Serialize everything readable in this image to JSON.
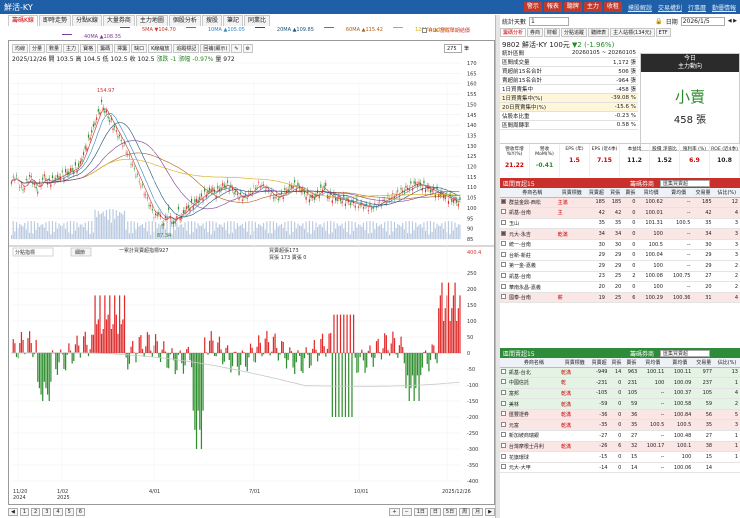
{
  "window": {
    "title": "鮮活-KY",
    "buttons": [
      "警示",
      "報表",
      "聽牌",
      "主力",
      "收租"
    ],
    "links": [
      "摸股解說",
      "交易權利",
      "行事曆",
      "勤優情報"
    ]
  },
  "tabs": [
    "籌碼K線",
    "即時走勢",
    "分點K線",
    "大量券商",
    "主力地圖",
    "個股分析",
    "搜股",
    "筆記",
    "同業比"
  ],
  "ma_legend_1": [
    {
      "label": "5MA ▼104.70",
      "color": "#c0392b"
    },
    {
      "label": "10MA ▲105.05",
      "color": "#2e86c1"
    },
    {
      "label": "20MA ▲109.85",
      "color": "#1a5276"
    },
    {
      "label": "60MA ▲115.42",
      "color": "#af601a"
    },
    {
      "label": "120MA ▲108.71",
      "color": "#d4ac0d"
    }
  ],
  "ma_legend_2": [
    {
      "label": "40MA ▲108.35",
      "color": "#7d3c98"
    }
  ],
  "ma_checkbox": "ROC當成年期結價",
  "chart_toolbar": [
    "均線",
    "分量",
    "數量",
    "主力",
    "寶格",
    "籌碼",
    "擇籌",
    "缺口",
    "K線縮放",
    "追蹤標記",
    "回補(顯示)"
  ],
  "zoom_value": "275",
  "zoom_unit": "筆",
  "price_info": {
    "text": "2025/12/26 開 103.5 高 104.5 低 102.5 收 102.5",
    "change": "漲跌 -1 漲幅 -0.97%",
    "vol": "量 972"
  },
  "high_label": "154.97",
  "low_label": "87.34",
  "price_axis": [
    "170",
    "165",
    "160",
    "155",
    "150",
    "145",
    "140",
    "135",
    "130",
    "125",
    "120",
    "115",
    "110",
    "105",
    "100",
    "95",
    "90",
    "85"
  ],
  "top_right_val": "400.4",
  "sub_legend": "一累計買賣超指標927",
  "sub_legend2": "買賣超張173",
  "sub_legend3": "買張 173 賣張 0",
  "sub_select": "分點指標",
  "sub_btn": "細節",
  "sub_axis": [
    "250",
    "200",
    "150",
    "100",
    "50",
    "0",
    "-50",
    "-100",
    "-150",
    "-200",
    "-250",
    "-300",
    "-350",
    "-400"
  ],
  "date_axis": [
    {
      "label": "11/20",
      "year": "2024"
    },
    {
      "label": "1/02",
      "year": "2025"
    },
    {
      "label": "4/01",
      "year": ""
    },
    {
      "label": "7/01",
      "year": ""
    },
    {
      "label": "10/01",
      "year": ""
    },
    {
      "label": "2025/12/26",
      "year": ""
    }
  ],
  "bottom_pages": [
    "1",
    "2",
    "3",
    "4",
    "5",
    "6"
  ],
  "bottom_zoom": [
    "1日",
    "日",
    "5日",
    "周",
    "月"
  ],
  "right": {
    "days_label": "統計天數",
    "days_value": "1",
    "date_label": "日期",
    "date_value": "2026/1/5",
    "tabs": [
      "籌碼分析",
      "券商",
      "財報",
      "分點追蹤",
      "聽牌表",
      "主人站標(134元)",
      "ETF"
    ],
    "stock": "9802 鮮活-KY",
    "price": "100元",
    "change": "▼2 (-1.96%)",
    "stats": [
      {
        "label": "統計區間",
        "value": "20260105 ~ 20260105",
        "span": true
      },
      {
        "label": "區間成交量",
        "value": "1,172 張"
      },
      {
        "label": "買超前15名合計",
        "value": "506 張"
      },
      {
        "label": "賣超前15名合計",
        "value": "-964 張"
      },
      {
        "label": "1日買賣集中",
        "value": "-458 張"
      },
      {
        "label": "1日買賣集中(%)",
        "value": "-39.08 %",
        "hl": true
      },
      {
        "label": "20日買賣集中(%)",
        "value": "-15.6 %",
        "hl": true
      },
      {
        "label": "佔股本比重",
        "value": "-0.23 %"
      },
      {
        "label": "區間周轉率",
        "value": "0.58 %"
      }
    ],
    "today": {
      "h1": "今日",
      "h2": "主力動向",
      "big": "小賣",
      "num": "458 張"
    },
    "fund": [
      {
        "label": "營收年增 YoY(%)",
        "value": "21.22",
        "color": "#c00"
      },
      {
        "label": "營收 MoM(%)",
        "value": "-0.41",
        "color": "#2a8a2a"
      },
      {
        "label": "EPS (年)",
        "value": "1.5",
        "color": "#c00"
      },
      {
        "label": "EPS (近4季)",
        "value": "7.15",
        "color": "#c00"
      },
      {
        "label": "本益比",
        "value": "11.2",
        "color": "#222"
      },
      {
        "label": "股價 淨值比",
        "value": "1.52",
        "color": "#222"
      },
      {
        "label": "殖利率 (%)",
        "value": "6.9",
        "color": "#c00"
      },
      {
        "label": "ROE (近4季)",
        "value": "10.8",
        "color": "#222"
      }
    ],
    "buy_header": "區間買超15",
    "buy_sel_label": "籌碼券商",
    "buy_sel": "匯集買賣超",
    "columns": [
      "券商名稱",
      "買賣標籤",
      "買賣超",
      "買張",
      "賣張",
      "買均價",
      "賣均價",
      "交易量",
      "佔比(%)"
    ],
    "buy_rows": [
      {
        "ck": true,
        "name": "群益金鼎-西松",
        "tag": "主滿",
        "net": "185",
        "buy": "185",
        "sell": "0",
        "bavg": "100.62",
        "savg": "--",
        "vol": "185",
        "pct": "12",
        "c": "pink"
      },
      {
        "ck": false,
        "name": "凱基-台南",
        "tag": "主",
        "net": "42",
        "buy": "42",
        "sell": "0",
        "bavg": "100.01",
        "savg": "--",
        "vol": "42",
        "pct": "4",
        "c": "pink"
      },
      {
        "ck": false,
        "name": "玉山",
        "tag": "",
        "net": "35",
        "buy": "35",
        "sell": "0",
        "bavg": "101.31",
        "savg": "100.5",
        "vol": "35",
        "pct": "3",
        "c": ""
      },
      {
        "ck": true,
        "name": "元大-永吉",
        "tag": "乾滿",
        "net": "34",
        "buy": "34",
        "sell": "0",
        "bavg": "100",
        "savg": "--",
        "vol": "34",
        "pct": "3",
        "c": "pink"
      },
      {
        "ck": false,
        "name": "統一-台南",
        "tag": "",
        "net": "30",
        "buy": "30",
        "sell": "0",
        "bavg": "100.5",
        "savg": "--",
        "vol": "30",
        "pct": "3",
        "c": ""
      },
      {
        "ck": false,
        "name": "台新-新莊",
        "tag": "",
        "net": "29",
        "buy": "29",
        "sell": "0",
        "bavg": "100.04",
        "savg": "--",
        "vol": "29",
        "pct": "3",
        "c": ""
      },
      {
        "ck": false,
        "name": "第一金-嘉義",
        "tag": "",
        "net": "29",
        "buy": "29",
        "sell": "0",
        "bavg": "100",
        "savg": "--",
        "vol": "29",
        "pct": "2",
        "c": ""
      },
      {
        "ck": false,
        "name": "凱基-台南",
        "tag": "",
        "net": "23",
        "buy": "25",
        "sell": "2",
        "bavg": "100.08",
        "savg": "100.75",
        "vol": "27",
        "pct": "2",
        "c": ""
      },
      {
        "ck": false,
        "name": "華南永昌-嘉義",
        "tag": "",
        "net": "20",
        "buy": "20",
        "sell": "0",
        "bavg": "100",
        "savg": "--",
        "vol": "20",
        "pct": "2",
        "c": ""
      },
      {
        "ck": false,
        "name": "國泰-台南",
        "tag": "薪",
        "net": "19",
        "buy": "25",
        "sell": "6",
        "bavg": "100.29",
        "savg": "100.36",
        "vol": "31",
        "pct": "4",
        "c": "pink"
      }
    ],
    "sell_header": "區間賣超15",
    "sell_sel_label": "籌碼券商",
    "sell_sel": "匯集買賣超",
    "sell_rows": [
      {
        "ck": false,
        "name": "凱基-台北",
        "tag": "乾滿",
        "net": "-949",
        "buy": "14",
        "sell": "963",
        "bavg": "100.11",
        "savg": "100.11",
        "vol": "977",
        "pct": "13",
        "c": "green"
      },
      {
        "ck": false,
        "name": "中國信託",
        "tag": "乾",
        "net": "-231",
        "buy": "0",
        "sell": "231",
        "bavg": "100",
        "savg": "100.09",
        "vol": "237",
        "pct": "1",
        "c": "green"
      },
      {
        "ck": false,
        "name": "富邦",
        "tag": "乾滿",
        "net": "-105",
        "buy": "0",
        "sell": "105",
        "bavg": "--",
        "savg": "100.37",
        "vol": "105",
        "pct": "4",
        "c": "green"
      },
      {
        "ck": false,
        "name": "美林",
        "tag": "乾滿",
        "net": "-59",
        "buy": "0",
        "sell": "59",
        "bavg": "--",
        "savg": "100.58",
        "vol": "59",
        "pct": "2",
        "c": "green"
      },
      {
        "ck": false,
        "name": "匯豐證券",
        "tag": "乾滿",
        "net": "-36",
        "buy": "0",
        "sell": "36",
        "bavg": "--",
        "savg": "100.84",
        "vol": "56",
        "pct": "5",
        "c": "pink"
      },
      {
        "ck": false,
        "name": "元富",
        "tag": "乾滿",
        "net": "-35",
        "buy": "0",
        "sell": "35",
        "bavg": "100.5",
        "savg": "100.5",
        "vol": "35",
        "pct": "3",
        "c": "pink"
      },
      {
        "ck": false,
        "name": "新加坡商瑞銀",
        "tag": "",
        "net": "-27",
        "buy": "0",
        "sell": "27",
        "bavg": "--",
        "savg": "100.48",
        "vol": "27",
        "pct": "1",
        "c": ""
      },
      {
        "ck": false,
        "name": "台灣摩根士丹利",
        "tag": "乾滿",
        "net": "-26",
        "buy": "6",
        "sell": "32",
        "bavg": "100.17",
        "savg": "100.1",
        "vol": "38",
        "pct": "1",
        "c": "pink"
      },
      {
        "ck": false,
        "name": "花旗環球",
        "tag": "",
        "net": "-15",
        "buy": "0",
        "sell": "15",
        "bavg": "--",
        "savg": "100",
        "vol": "15",
        "pct": "1",
        "c": ""
      },
      {
        "ck": false,
        "name": "元大-大甲",
        "tag": "",
        "net": "-14",
        "buy": "0",
        "sell": "14",
        "bavg": "--",
        "savg": "100.06",
        "vol": "14",
        "pct": "",
        "c": ""
      }
    ]
  }
}
